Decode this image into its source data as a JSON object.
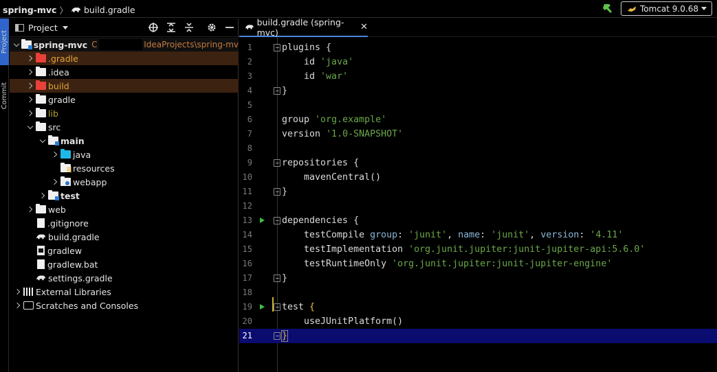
{
  "titlebar": {
    "project": "spring-mvc",
    "file": "build.gradle",
    "run_config": "Tomcat 9.0.68"
  },
  "stripe": {
    "project_tab": "Project",
    "commit_tab": "Commit"
  },
  "panel": {
    "title": "Project",
    "root": {
      "name": "spring-mvc",
      "path_prefix": "C",
      "path_suffix": "IdeaProjects\\spring-mv"
    },
    "items": [
      {
        "label": ".gradle"
      },
      {
        "label": ".idea"
      },
      {
        "label": "build"
      },
      {
        "label": "gradle"
      },
      {
        "label": "lib"
      },
      {
        "label": "src"
      },
      {
        "label": "main"
      },
      {
        "label": "java"
      },
      {
        "label": "resources"
      },
      {
        "label": "webapp"
      },
      {
        "label": "test"
      },
      {
        "label": "web"
      },
      {
        "label": ".gitignore"
      },
      {
        "label": "build.gradle"
      },
      {
        "label": "gradlew"
      },
      {
        "label": "gradlew.bat"
      },
      {
        "label": "settings.gradle"
      },
      {
        "label": "External Libraries"
      },
      {
        "label": "Scratches and Consoles"
      }
    ]
  },
  "editor": {
    "tab_label": "build.gradle (spring-mvc)",
    "line_numbers": [
      "1",
      "2",
      "3",
      "4",
      "5",
      "6",
      "7",
      "8",
      "9",
      "10",
      "11",
      "12",
      "13",
      "14",
      "15",
      "16",
      "17",
      "18",
      "19",
      "20",
      "21"
    ],
    "code": {
      "l1": "plugins {",
      "l2a": "    id ",
      "l2b": "'java'",
      "l3a": "    id ",
      "l3b": "'war'",
      "l4": "}",
      "l6a": "group ",
      "l6b": "'org.example'",
      "l7a": "version ",
      "l7b": "'1.0-SNAPSHOT'",
      "l9": "repositories {",
      "l10": "    mavenCentral()",
      "l11": "}",
      "l13": "dependencies {",
      "l14a": "    testCompile ",
      "l14b": "group",
      "l14c": ": ",
      "l14d": "'junit'",
      "l14e": ", ",
      "l14f": "name",
      "l14g": ": ",
      "l14h": "'junit'",
      "l14i": ", ",
      "l14j": "version",
      "l14k": ": ",
      "l14l": "'4.11'",
      "l15a": "    testImplementation ",
      "l15b": "'org.junit.jupiter:junit-jupiter-api:5.6.0'",
      "l16a": "    testRuntimeOnly ",
      "l16b": "'org.junit.jupiter:junit-jupiter-engine'",
      "l17": "}",
      "l19a": "test ",
      "l19b": "{",
      "l20": "    useJUnitPlatform()",
      "l21": "}"
    }
  },
  "colors": {
    "accent": "#4a88e0",
    "current_line": "#0b0c70",
    "string": "#6ba84a",
    "excluded_highlight": "#3c2210"
  }
}
